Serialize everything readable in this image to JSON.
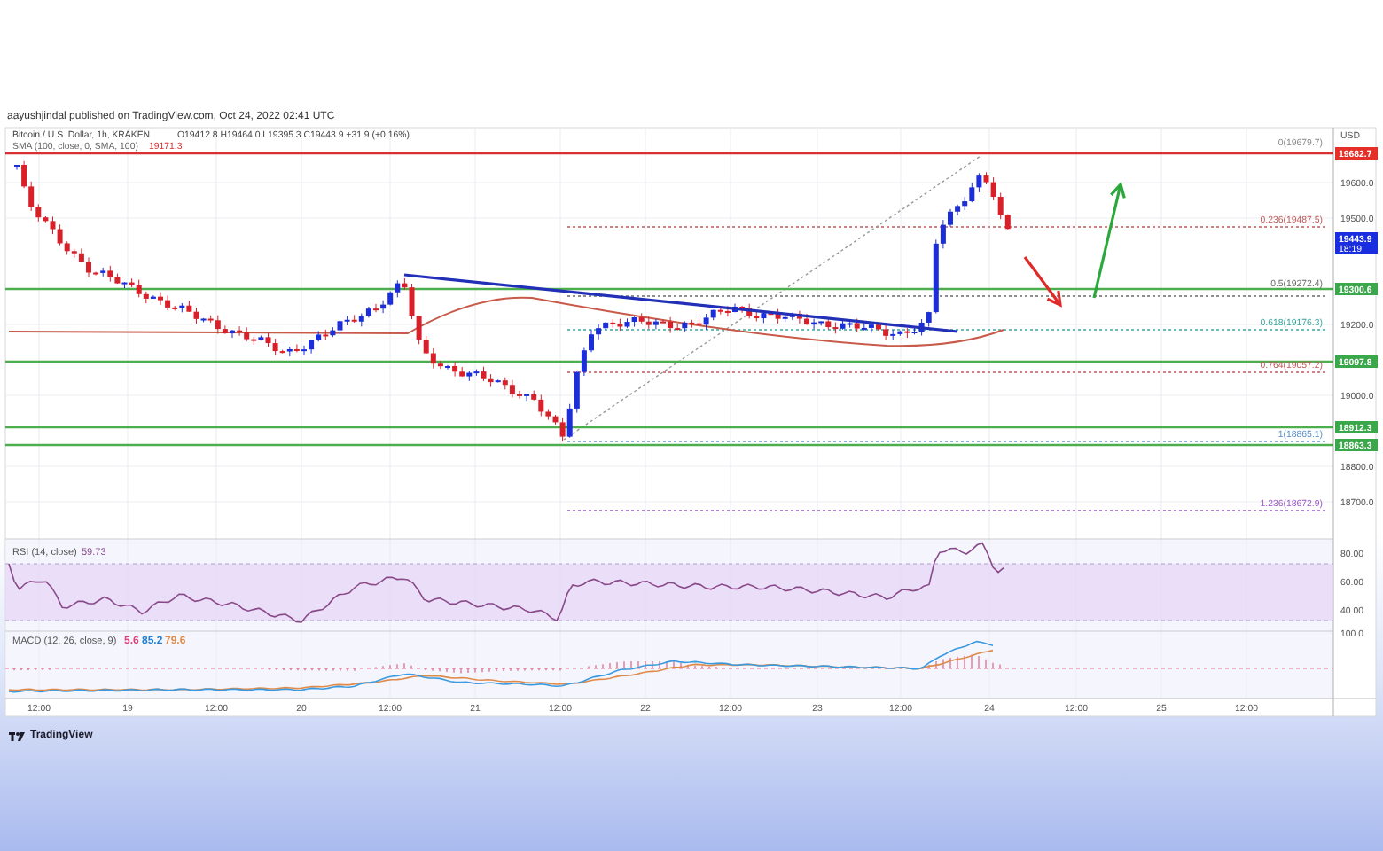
{
  "header": {
    "byline": "aayushjindal published on TradingView.com, Oct 24, 2022 02:41 UTC"
  },
  "legend": {
    "symbol": "Bitcoin / U.S. Dollar, 1h, KRAKEN",
    "ohlc": "O19412.8 H19464.0 L19395.3 C19443.9 +31.9 (+0.16%)",
    "sma_label": "SMA (100, close, 0, SMA, 100)",
    "sma_value": "19171.3"
  },
  "price_axis": {
    "unit": "USD",
    "ticks": [
      "19600.0",
      "19500.0",
      "19200.0",
      "19000.0",
      "18800.0",
      "18700.0"
    ]
  },
  "price_tags": [
    {
      "kind": "high",
      "text": "19682.7"
    },
    {
      "kind": "last",
      "text": "19443.9",
      "sub": "18:19"
    },
    {
      "kind": "level",
      "text": "19300.6"
    },
    {
      "kind": "level",
      "text": "19097.8"
    },
    {
      "kind": "level",
      "text": "18912.3"
    },
    {
      "kind": "level",
      "text": "18863.3"
    }
  ],
  "fib_levels": [
    {
      "label": "0(19679.7)",
      "color": "#8a8a8a"
    },
    {
      "label": "0.236(19487.5)",
      "color": "#c25a5a"
    },
    {
      "label": "0.5(19272.4)",
      "color": "#6a6a6a"
    },
    {
      "label": "0.618(19176.3)",
      "color": "#3aa6a0"
    },
    {
      "label": "0.764(19057.2)",
      "color": "#c25a5a"
    },
    {
      "label": "1(18865.1)",
      "color": "#5a90c8"
    },
    {
      "label": "1.236(18672.9)",
      "color": "#9a5ac8"
    }
  ],
  "rsi": {
    "label": "RSI (14, close)",
    "value": "59.73",
    "ticks": [
      "80.00",
      "60.00",
      "40.00"
    ]
  },
  "macd": {
    "label": "MACD (12, 26, close, 9)",
    "ticks": [
      "100.0"
    ],
    "values": [
      {
        "text": "5.6",
        "color": "#e0407a"
      },
      {
        "text": "85.2",
        "color": "#1e7fd8"
      },
      {
        "text": "79.6",
        "color": "#e08a4a"
      }
    ]
  },
  "time_axis": [
    "12:00",
    "19",
    "12:00",
    "20",
    "12:00",
    "21",
    "12:00",
    "22",
    "12:00",
    "23",
    "12:00",
    "24",
    "12:00",
    "25",
    "12:00"
  ],
  "footer": {
    "brand": "TradingView"
  }
}
